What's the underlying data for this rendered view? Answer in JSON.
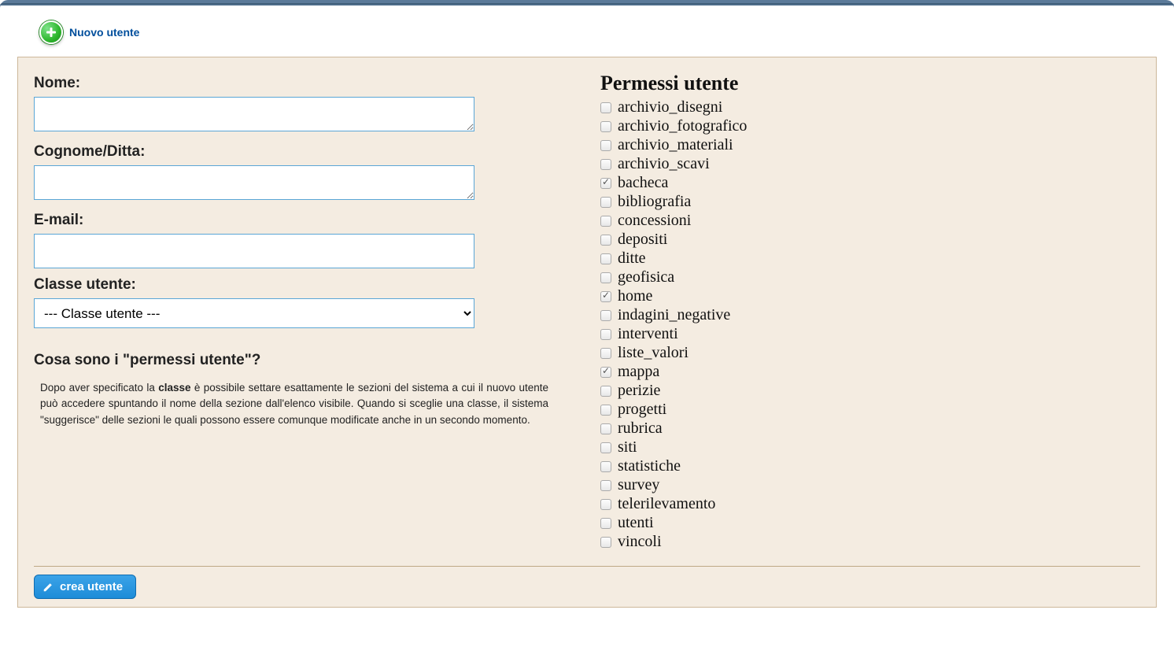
{
  "header": {
    "title": "Nuovo utente",
    "icon": "plus-circle-icon"
  },
  "form": {
    "name_label": "Nome:",
    "name_value": "",
    "surname_label": "Cognome/Ditta:",
    "surname_value": "",
    "email_label": "E-mail:",
    "email_value": "",
    "class_label": "Classe utente:",
    "class_selected": "--- Classe utente ---"
  },
  "help": {
    "heading": "Cosa sono i \"permessi utente\"?",
    "body_prefix": "Dopo aver specificato la ",
    "body_bold": "classe",
    "body_suffix": " è possibile settare esattamente le sezioni del sistema a cui il nuovo utente può accedere spuntando il nome della sezione dall'elenco visibile. Quando si sceglie una classe, il sistema \"suggerisce\" delle sezioni le quali possono essere comunque modificate anche in un secondo momento."
  },
  "permissions": {
    "heading": "Permessi utente",
    "items": [
      {
        "label": "archivio_disegni",
        "checked": false
      },
      {
        "label": "archivio_fotografico",
        "checked": false
      },
      {
        "label": "archivio_materiali",
        "checked": false
      },
      {
        "label": "archivio_scavi",
        "checked": false
      },
      {
        "label": "bacheca",
        "checked": true
      },
      {
        "label": "bibliografia",
        "checked": false
      },
      {
        "label": "concessioni",
        "checked": false
      },
      {
        "label": "depositi",
        "checked": false
      },
      {
        "label": "ditte",
        "checked": false
      },
      {
        "label": "geofisica",
        "checked": false
      },
      {
        "label": "home",
        "checked": true
      },
      {
        "label": "indagini_negative",
        "checked": false
      },
      {
        "label": "interventi",
        "checked": false
      },
      {
        "label": "liste_valori",
        "checked": false
      },
      {
        "label": "mappa",
        "checked": true
      },
      {
        "label": "perizie",
        "checked": false
      },
      {
        "label": "progetti",
        "checked": false
      },
      {
        "label": "rubrica",
        "checked": false
      },
      {
        "label": "siti",
        "checked": false
      },
      {
        "label": "statistiche",
        "checked": false
      },
      {
        "label": "survey",
        "checked": false
      },
      {
        "label": "telerilevamento",
        "checked": false
      },
      {
        "label": "utenti",
        "checked": false
      },
      {
        "label": "vincoli",
        "checked": false
      }
    ]
  },
  "actions": {
    "create_label": "crea utente"
  }
}
